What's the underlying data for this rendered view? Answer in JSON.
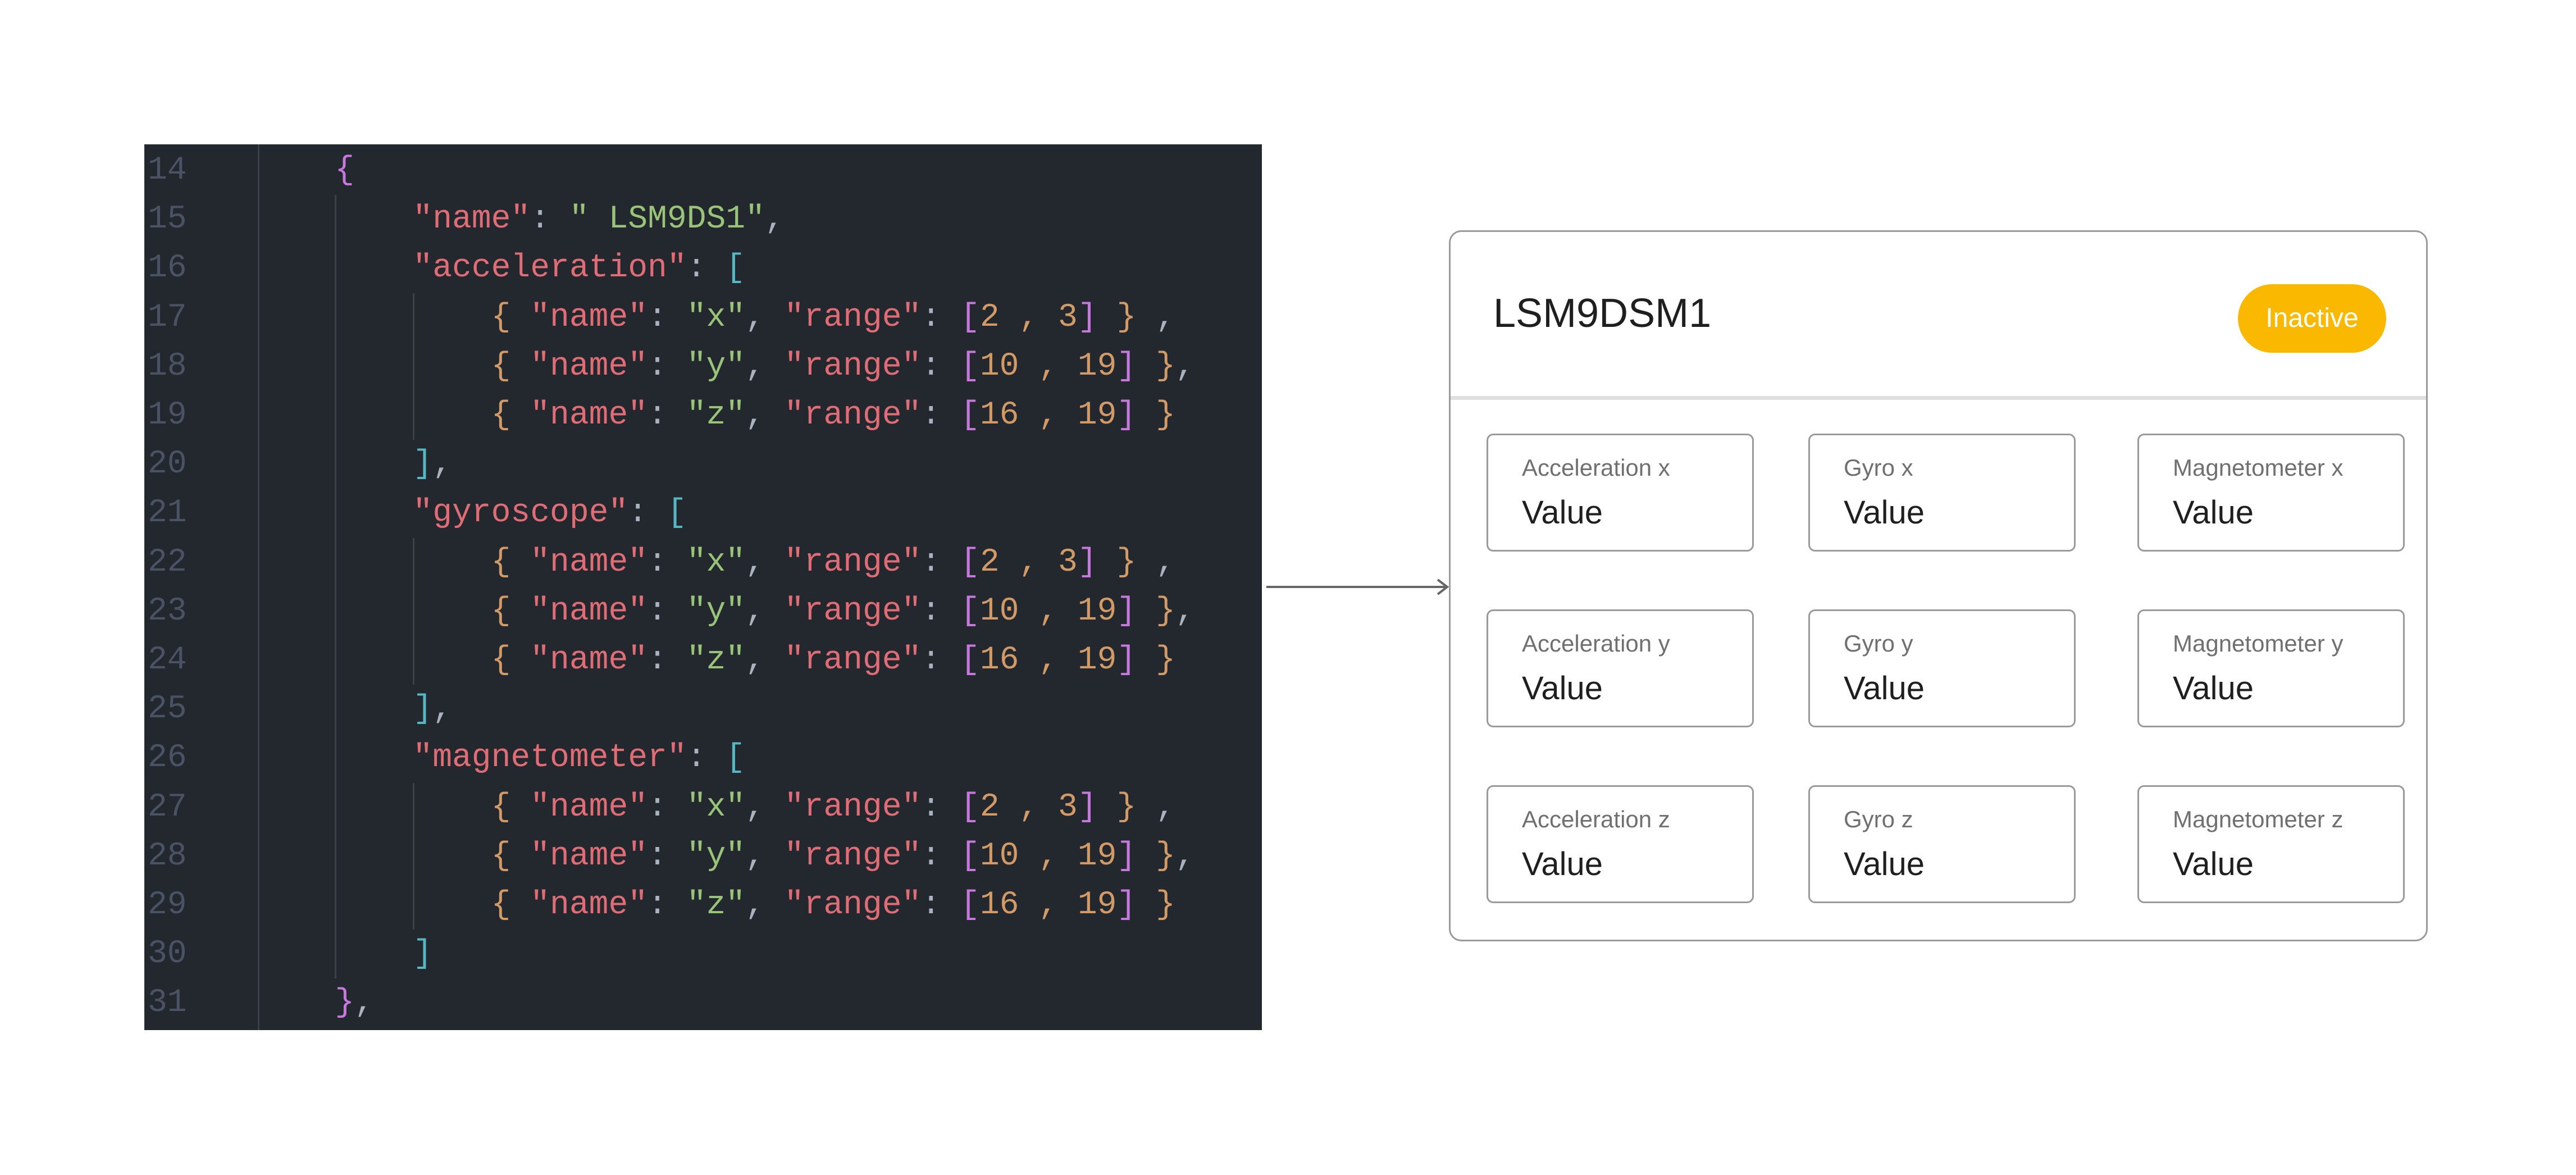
{
  "code": {
    "first_line": 14,
    "lines": [
      {
        "indent": 1,
        "tokens": [
          [
            "{",
            "b1"
          ]
        ]
      },
      {
        "indent": 2,
        "tokens": [
          [
            "\"name\"",
            "k"
          ],
          [
            ": ",
            "p"
          ],
          [
            "\" LSM9DS1\"",
            "s"
          ],
          [
            ",",
            "p"
          ]
        ]
      },
      {
        "indent": 2,
        "tokens": [
          [
            "\"acceleration\"",
            "k"
          ],
          [
            ": ",
            "p"
          ],
          [
            "[",
            "b2"
          ]
        ]
      },
      {
        "indent": 3,
        "tokens": [
          [
            "{ ",
            "b3"
          ],
          [
            "\"name\"",
            "k"
          ],
          [
            ": ",
            "p"
          ],
          [
            "\"x\"",
            "s"
          ],
          [
            ", ",
            "p"
          ],
          [
            "\"range\"",
            "k"
          ],
          [
            ": ",
            "p"
          ],
          [
            "[",
            "b4"
          ],
          [
            "2 , 3",
            "n"
          ],
          [
            "]",
            "b4"
          ],
          [
            " }",
            "b3"
          ],
          [
            " ,",
            "p"
          ]
        ]
      },
      {
        "indent": 3,
        "tokens": [
          [
            "{ ",
            "b3"
          ],
          [
            "\"name\"",
            "k"
          ],
          [
            ": ",
            "p"
          ],
          [
            "\"y\"",
            "s"
          ],
          [
            ", ",
            "p"
          ],
          [
            "\"range\"",
            "k"
          ],
          [
            ": ",
            "p"
          ],
          [
            "[",
            "b4"
          ],
          [
            "10 , 19",
            "n"
          ],
          [
            "]",
            "b4"
          ],
          [
            " }",
            "b3"
          ],
          [
            ",",
            "p"
          ]
        ]
      },
      {
        "indent": 3,
        "tokens": [
          [
            "{ ",
            "b3"
          ],
          [
            "\"name\"",
            "k"
          ],
          [
            ": ",
            "p"
          ],
          [
            "\"z\"",
            "s"
          ],
          [
            ", ",
            "p"
          ],
          [
            "\"range\"",
            "k"
          ],
          [
            ": ",
            "p"
          ],
          [
            "[",
            "b4"
          ],
          [
            "16 , 19",
            "n"
          ],
          [
            "]",
            "b4"
          ],
          [
            " }",
            "b3"
          ]
        ]
      },
      {
        "indent": 2,
        "tokens": [
          [
            "]",
            "b2"
          ],
          [
            ",",
            "p"
          ]
        ]
      },
      {
        "indent": 2,
        "tokens": [
          [
            "\"gyroscope\"",
            "k"
          ],
          [
            ": ",
            "p"
          ],
          [
            "[",
            "b2"
          ]
        ]
      },
      {
        "indent": 3,
        "tokens": [
          [
            "{ ",
            "b3"
          ],
          [
            "\"name\"",
            "k"
          ],
          [
            ": ",
            "p"
          ],
          [
            "\"x\"",
            "s"
          ],
          [
            ", ",
            "p"
          ],
          [
            "\"range\"",
            "k"
          ],
          [
            ": ",
            "p"
          ],
          [
            "[",
            "b4"
          ],
          [
            "2 , 3",
            "n"
          ],
          [
            "]",
            "b4"
          ],
          [
            " }",
            "b3"
          ],
          [
            " ,",
            "p"
          ]
        ]
      },
      {
        "indent": 3,
        "tokens": [
          [
            "{ ",
            "b3"
          ],
          [
            "\"name\"",
            "k"
          ],
          [
            ": ",
            "p"
          ],
          [
            "\"y\"",
            "s"
          ],
          [
            ", ",
            "p"
          ],
          [
            "\"range\"",
            "k"
          ],
          [
            ": ",
            "p"
          ],
          [
            "[",
            "b4"
          ],
          [
            "10 , 19",
            "n"
          ],
          [
            "]",
            "b4"
          ],
          [
            " }",
            "b3"
          ],
          [
            ",",
            "p"
          ]
        ]
      },
      {
        "indent": 3,
        "tokens": [
          [
            "{ ",
            "b3"
          ],
          [
            "\"name\"",
            "k"
          ],
          [
            ": ",
            "p"
          ],
          [
            "\"z\"",
            "s"
          ],
          [
            ", ",
            "p"
          ],
          [
            "\"range\"",
            "k"
          ],
          [
            ": ",
            "p"
          ],
          [
            "[",
            "b4"
          ],
          [
            "16 , 19",
            "n"
          ],
          [
            "]",
            "b4"
          ],
          [
            " }",
            "b3"
          ]
        ]
      },
      {
        "indent": 2,
        "tokens": [
          [
            "]",
            "b2"
          ],
          [
            ",",
            "p"
          ]
        ]
      },
      {
        "indent": 2,
        "tokens": [
          [
            "\"magnetometer\"",
            "k"
          ],
          [
            ": ",
            "p"
          ],
          [
            "[",
            "b2"
          ]
        ]
      },
      {
        "indent": 3,
        "tokens": [
          [
            "{ ",
            "b3"
          ],
          [
            "\"name\"",
            "k"
          ],
          [
            ": ",
            "p"
          ],
          [
            "\"x\"",
            "s"
          ],
          [
            ", ",
            "p"
          ],
          [
            "\"range\"",
            "k"
          ],
          [
            ": ",
            "p"
          ],
          [
            "[",
            "b4"
          ],
          [
            "2 , 3",
            "n"
          ],
          [
            "]",
            "b4"
          ],
          [
            " }",
            "b3"
          ],
          [
            " ,",
            "p"
          ]
        ]
      },
      {
        "indent": 3,
        "tokens": [
          [
            "{ ",
            "b3"
          ],
          [
            "\"name\"",
            "k"
          ],
          [
            ": ",
            "p"
          ],
          [
            "\"y\"",
            "s"
          ],
          [
            ", ",
            "p"
          ],
          [
            "\"range\"",
            "k"
          ],
          [
            ": ",
            "p"
          ],
          [
            "[",
            "b4"
          ],
          [
            "10 , 19",
            "n"
          ],
          [
            "]",
            "b4"
          ],
          [
            " }",
            "b3"
          ],
          [
            ",",
            "p"
          ]
        ]
      },
      {
        "indent": 3,
        "tokens": [
          [
            "{ ",
            "b3"
          ],
          [
            "\"name\"",
            "k"
          ],
          [
            ": ",
            "p"
          ],
          [
            "\"z\"",
            "s"
          ],
          [
            ", ",
            "p"
          ],
          [
            "\"range\"",
            "k"
          ],
          [
            ": ",
            "p"
          ],
          [
            "[",
            "b4"
          ],
          [
            "16 , 19",
            "n"
          ],
          [
            "]",
            "b4"
          ],
          [
            " }",
            "b3"
          ]
        ]
      },
      {
        "indent": 2,
        "tokens": [
          [
            "]",
            "b2"
          ]
        ]
      },
      {
        "indent": 1,
        "tokens": [
          [
            "}",
            "b1"
          ],
          [
            ",",
            "p"
          ]
        ]
      }
    ]
  },
  "card": {
    "title": "LSM9DSM1",
    "status": "Inactive",
    "status_color": "#fbb800",
    "tiles": [
      [
        {
          "label": "Acceleration x",
          "value": "Value"
        },
        {
          "label": "Gyro x",
          "value": "Value"
        },
        {
          "label": "Magnetometer x",
          "value": "Value"
        }
      ],
      [
        {
          "label": "Acceleration y",
          "value": "Value"
        },
        {
          "label": "Gyro y",
          "value": "Value"
        },
        {
          "label": "Magnetometer y",
          "value": "Value"
        }
      ],
      [
        {
          "label": "Acceleration z",
          "value": "Value"
        },
        {
          "label": "Gyro z",
          "value": "Value"
        },
        {
          "label": "Magnetometer z",
          "value": "Value"
        }
      ]
    ]
  }
}
